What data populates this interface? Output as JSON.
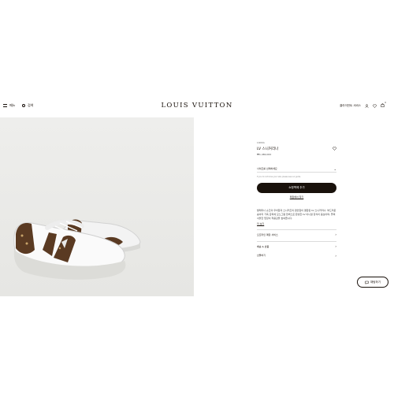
{
  "header": {
    "menu_label": "메뉴",
    "search_label": "검색",
    "logo": "LOUIS VUITTON",
    "contact_label": "클라이언트 서비스",
    "bag_count": "0"
  },
  "product": {
    "ref": "1AR9QL",
    "name": "LV 스니커리나",
    "price": "₩1,480,000",
    "size_select": "사이즈를 선택하세요",
    "size_note": "If you do not know your size, please see our guide.",
    "add_to_cart": "쇼핑백에 추가",
    "store_link": "매장에서 찾기",
    "description": "발레리나 슈즈의 우아함과 스니커즈의 편안함이 결합된 LV 스니커리나. 부드러운 송아지 가죽 갑피에 모노그램 캔버스로 완성한 LV 이니셜 장식이 돋보이며, 플렉서블한 밑창이 착용감을 높여줍니다.",
    "more_label": "더 보기",
    "rows": [
      {
        "label": "오프라인 매장 서비스"
      },
      {
        "label": "배송 & 반품"
      },
      {
        "label": "선물하기"
      }
    ]
  },
  "chat": {
    "label": "채팅하기"
  },
  "colors": {
    "accent": "#19110b",
    "hero_bg": "#eeeeec",
    "monogram_brown": "#5a3a22"
  }
}
